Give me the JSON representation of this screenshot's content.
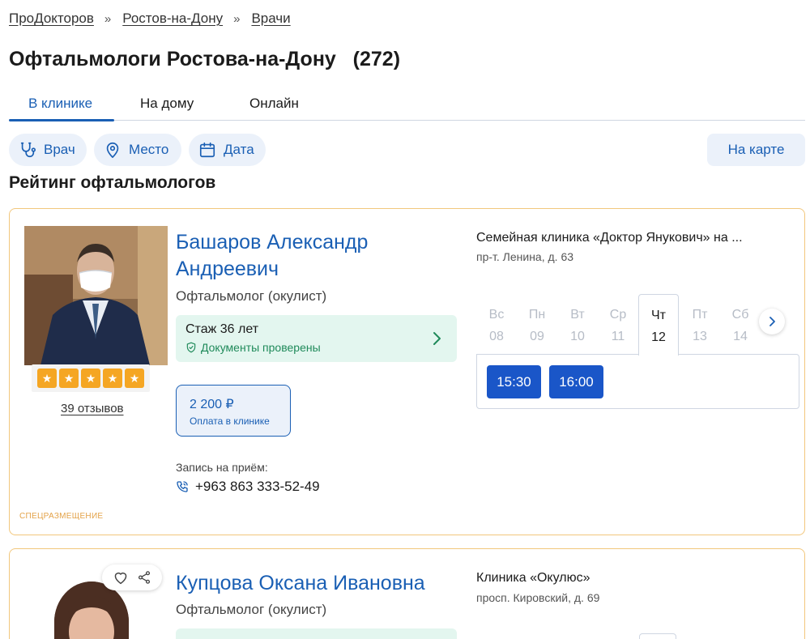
{
  "breadcrumb": [
    "ПроДокторов",
    "Ростов-на-Дону",
    "Врачи"
  ],
  "breadcrumb_separator": "»",
  "page_title": "Офтальмологи Ростова-на-Дону   (272)",
  "tabs": [
    {
      "label": "В клинике",
      "active": true
    },
    {
      "label": "На дому",
      "active": false
    },
    {
      "label": "Онлайн",
      "active": false
    }
  ],
  "filters": {
    "doctor": "Врач",
    "place": "Место",
    "date": "Дата",
    "map": "На карте"
  },
  "section_title": "Рейтинг офтальмологов",
  "colors": {
    "accent": "#1a5fb4",
    "slot": "#1a56c8",
    "star": "#f5a623",
    "card_border": "#f2c77c",
    "verified": "#1f8a5a"
  },
  "doctors": [
    {
      "name": "Башаров Александр Андреевич",
      "specialty": "Офтальмолог (окулист)",
      "rating_stars": 5,
      "reviews": "39 отзывов",
      "experience": "Стаж 36 лет",
      "documents": "Документы проверены",
      "price": "2 200 ₽",
      "price_note": "Оплата в клинике",
      "appointment_label": "Запись на приём:",
      "phone": "+963 863 333-52-49",
      "promo": "СПЕЦРАЗМЕЩЕНИЕ",
      "clinic": "Семейная клиника «Доктор Янукович» на ...",
      "address": "пр-т. Ленина, д. 63",
      "days": [
        {
          "dow": "Вс",
          "date": "08",
          "active": false
        },
        {
          "dow": "Пн",
          "date": "09",
          "active": false
        },
        {
          "dow": "Вт",
          "date": "10",
          "active": false
        },
        {
          "dow": "Ср",
          "date": "11",
          "active": false
        },
        {
          "dow": "Чт",
          "date": "12",
          "active": true
        },
        {
          "dow": "Пт",
          "date": "13",
          "active": false
        },
        {
          "dow": "Сб",
          "date": "14",
          "active": false
        }
      ],
      "slots": [
        "15:30",
        "16:00"
      ]
    },
    {
      "name": "Купцова Оксана Ивановна",
      "specialty": "Офтальмолог (окулист)",
      "clinic": "Клиника «Окулюс»",
      "address": "просп. Кировский, д. 69"
    }
  ]
}
